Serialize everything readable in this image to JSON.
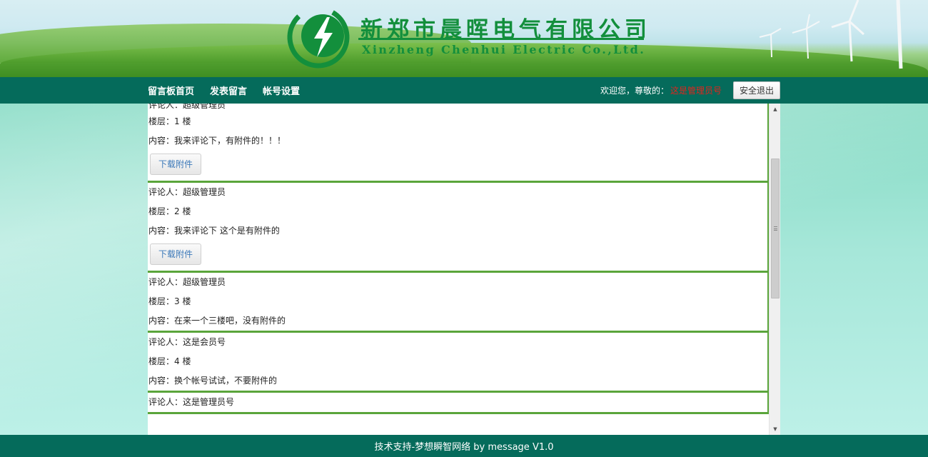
{
  "header": {
    "company_cn": "新郑市晨晖电气有限公司",
    "company_en": "Xinzheng Chenhui Electric Co.,Ltd.",
    "logo_icon": "lightning-bolt-logo-icon",
    "brand_color": "#138f3c"
  },
  "nav": {
    "links": [
      "留言板首页",
      "发表留言",
      "帐号设置"
    ],
    "welcome": "欢迎您，尊敬的：",
    "username": "这是管理员号",
    "logout": "安全退出"
  },
  "comments": [
    {
      "author": "评论人：超级管理员",
      "floor": "楼层：1 楼",
      "content": "内容：我来评论下，有附件的！！！",
      "download": "下载附件"
    },
    {
      "author": "评论人：超级管理员",
      "floor": "楼层：2 楼",
      "content": "内容：我来评论下 这个是有附件的",
      "download": "下载附件"
    },
    {
      "author": "评论人：超级管理员",
      "floor": "楼层：3 楼",
      "content": "内容：在来一个三楼吧，没有附件的"
    },
    {
      "author": "评论人：这是会员号",
      "floor": "楼层：4 楼",
      "content": "内容：换个帐号试试，不要附件的"
    },
    {
      "author": "评论人：这是管理员号"
    }
  ],
  "footer": {
    "text": "技术支持-梦想瞬智网络 by message V1.0"
  },
  "colors": {
    "nav_bg": "#056b5b",
    "comment_border": "#5aa53b",
    "username_color": "#e0261e"
  }
}
